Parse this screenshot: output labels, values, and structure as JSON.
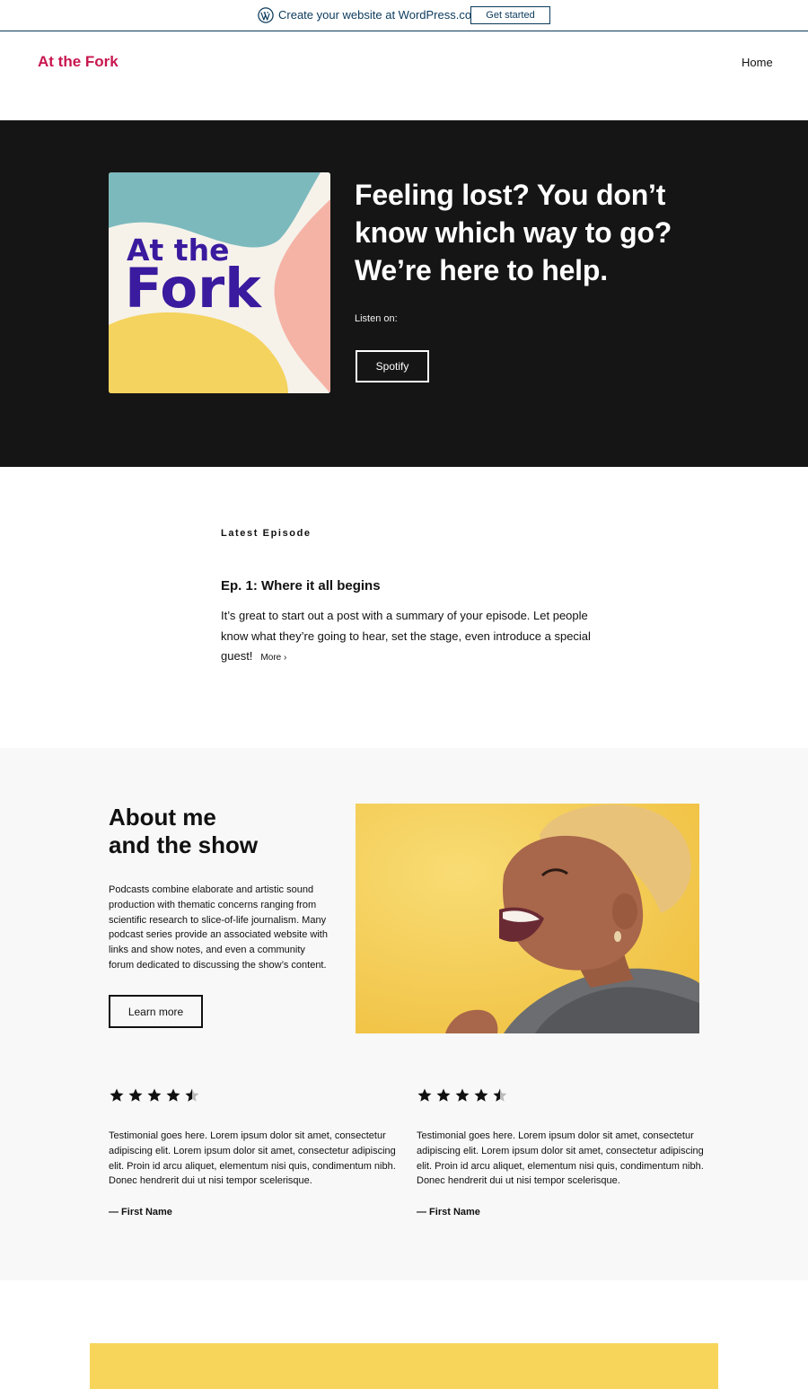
{
  "wp_bar": {
    "text": "Create your website at WordPress.com",
    "button": "Get started",
    "logo_icon": "wordpress-logo-icon"
  },
  "header": {
    "site_title": "At the Fork",
    "nav": [
      "Home"
    ]
  },
  "hero": {
    "cover_text": [
      "At the",
      "Fork"
    ],
    "heading": "Feeling lost? You don’t know which way to go? We’re here to help.",
    "listen_label": "Listen on:",
    "listen_button": "Spotify"
  },
  "latest": {
    "label": "Latest Episode",
    "title": "Ep. 1: Where it all begins",
    "summary": "It’s great to start out a post with a summary of your episode. Let people know what they’re going to hear, set the stage, even introduce a special guest!",
    "more": "More ›"
  },
  "about": {
    "heading_line1": "About me",
    "heading_line2": "and the show",
    "body": "Podcasts combine elaborate and artistic sound production with thematic concerns ranging from scientific research to slice-of-life journalism. Many podcast series provide an associated website with links and show notes, and even a community forum dedicated to discussing the show’s content.",
    "button": "Learn more",
    "testimonials": [
      {
        "rating": 4.5,
        "text": "Testimonial goes here. Lorem ipsum dolor sit amet, consectetur adipiscing elit. Lorem ipsum dolor sit amet, consectetur adipiscing elit. Proin id arcu aliquet, elementum nisi quis, condimentum nibh. Donec hendrerit dui ut nisi tempor scelerisque.",
        "name": "— First Name"
      },
      {
        "rating": 4.5,
        "text": "Testimonial goes here. Lorem ipsum dolor sit amet, consectetur adipiscing elit. Lorem ipsum dolor sit amet, consectetur adipiscing elit. Proin id arcu aliquet, elementum nisi quis, condimentum nibh. Donec hendrerit dui ut nisi tempor scelerisque.",
        "name": "— First Name"
      }
    ]
  },
  "colors": {
    "site_title": "#c8174f",
    "hero_bg": "#151515",
    "about_bg": "#f7f8f7",
    "yellow": "#f7d55b",
    "wp_blue": "#0b3a5c",
    "cover_purple": "#3a1a9e"
  }
}
